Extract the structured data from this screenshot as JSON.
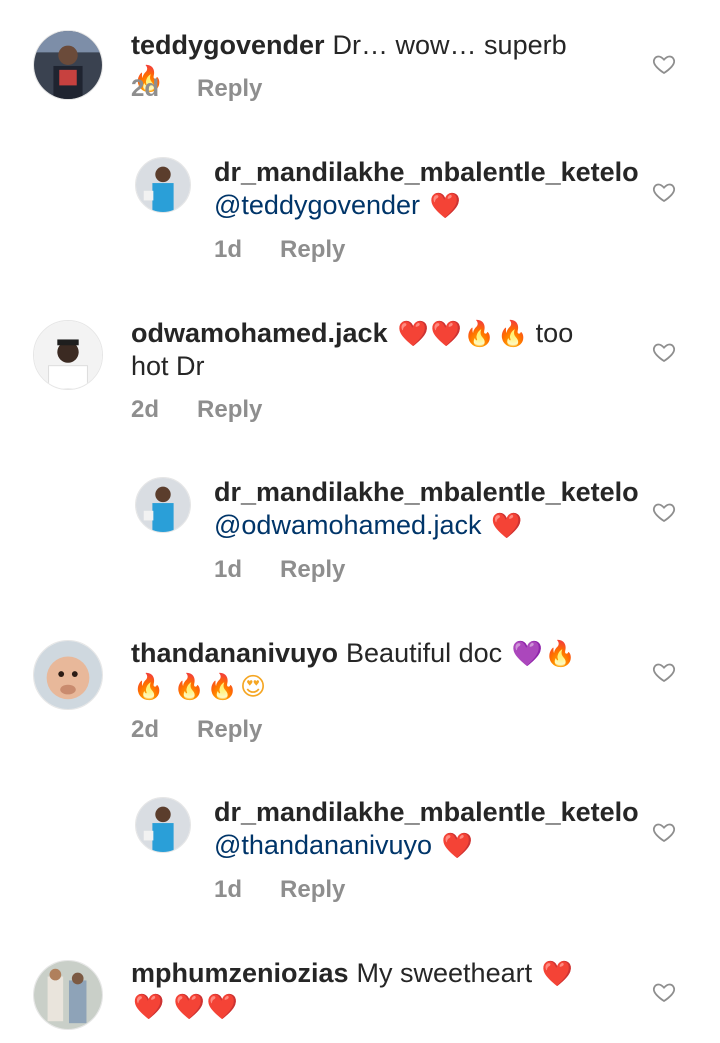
{
  "comments": [
    {
      "type": "top",
      "username": "teddygovender",
      "text": "Dr… wow… superb",
      "emojis": [
        "🔥"
      ],
      "time": "2d",
      "reply": "Reply",
      "avatar_icon": "avatar-photo"
    },
    {
      "type": "reply",
      "username": "dr_mandilakhe_mbalentle_ketelo",
      "mention": "@teddygovender",
      "emojis": [
        "❤️"
      ],
      "time": "1d",
      "reply": "Reply",
      "avatar_icon": "avatar-photo"
    },
    {
      "type": "top",
      "username": "odwamohamed.jack",
      "emojis_before": [
        "❤️",
        "❤️",
        "🔥",
        "🔥"
      ],
      "text": "too hot Dr",
      "time": "2d",
      "reply": "Reply",
      "avatar_icon": "avatar-photo"
    },
    {
      "type": "reply",
      "username": "dr_mandilakhe_mbalentle_ketelo",
      "mention": "@odwamohamed.jack",
      "emojis": [
        "❤️"
      ],
      "time": "1d",
      "reply": "Reply",
      "avatar_icon": "avatar-photo"
    },
    {
      "type": "top",
      "username": "thandananivuyo",
      "text": "Beautiful doc",
      "emojis": [
        "💜",
        "🔥",
        "🔥",
        "🔥",
        "🔥",
        "😍"
      ],
      "time": "2d",
      "reply": "Reply",
      "avatar_icon": "avatar-photo"
    },
    {
      "type": "reply",
      "username": "dr_mandilakhe_mbalentle_ketelo",
      "mention": "@thandananivuyo",
      "emojis": [
        "❤️"
      ],
      "time": "1d",
      "reply": "Reply",
      "avatar_icon": "avatar-photo"
    },
    {
      "type": "top",
      "username": "mphumzeniozias",
      "text": "My sweetheart",
      "emojis": [
        "❤️",
        "❤️",
        "❤️",
        "❤️"
      ],
      "avatar_icon": "avatar-photo"
    }
  ],
  "icons": {
    "like": "heart-outline-icon"
  },
  "colors": {
    "text": "#262626",
    "meta": "#8e8e8e",
    "mention": "#003569",
    "like_stroke": "#8e8e8e"
  }
}
